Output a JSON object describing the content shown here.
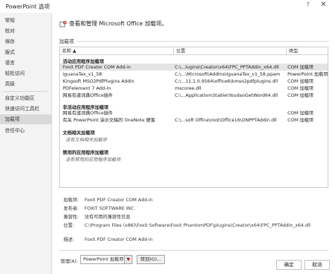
{
  "window": {
    "title": "PowerPoint 选项",
    "help": "?",
    "close": "✕"
  },
  "sidebar": {
    "items": [
      {
        "label": "常规"
      },
      {
        "label": "校对"
      },
      {
        "label": "保存"
      },
      {
        "label": "版式"
      },
      {
        "label": "语言"
      },
      {
        "label": "轻松访问"
      },
      {
        "label": "高级"
      },
      {
        "label": "自定义功能区"
      },
      {
        "label": "快速访问工具栏"
      },
      {
        "label": "加载项"
      },
      {
        "label": "信任中心"
      }
    ]
  },
  "header": {
    "text": "查看和管理 Microsoft Office 加载项。"
  },
  "addins": {
    "section_label": "加载项",
    "columns": {
      "name": "名称 ▲",
      "location": "位置",
      "type": "类型"
    },
    "groups": [
      {
        "title": "活动应用程序加载项",
        "rows": [
          {
            "name": "Foxit PDF Creator COM Add-in",
            "location": "C:\\...lugins\\Creator\\x64\\FPC_PPTAddin_x64.dll",
            "type": "COM 加载项"
          },
          {
            "name": "IguanaTex_v1_58",
            "location": "C:\\...\\Microsoft\\AddIns\\IguanaTex_v1_58.ppam",
            "type": "PowerPoint 加载项"
          },
          {
            "name": "Kingsoft MSO2PdfPlugins Addin",
            "location": "C:\\...11.1.0.9564\\office6\\kmso2pdfplugins.dll",
            "type": "COM 加载项"
          },
          {
            "name": "PDFelement 7 Add-In",
            "location": "mscoree.dll",
            "type": "COM 加载项"
          },
          {
            "name": "网易有道词典Office插件",
            "location": "C:\\...Application\\Stable\\YoudaoGetWord64.dll",
            "type": "COM 加载项"
          }
        ]
      },
      {
        "title": "非活动应用程序加载项",
        "rows": [
          {
            "name": "网易有道词典Office插件",
            "location": "",
            "type": "COM 加载项"
          },
          {
            "name": "有关 PowerPoint 演示文稿的 OneNote 便笺",
            "location": "C:\\...soft Office\\root\\Office16\\ONPPTAddin.dll",
            "type": "COM 加载项"
          }
        ]
      },
      {
        "title": "文档相关加载项",
        "empty": "没有文档相关加载项"
      },
      {
        "title": "禁用的应用程序加载项",
        "empty": "没有禁用的应用程序加载项"
      }
    ]
  },
  "details": {
    "addin_label": "加载项:",
    "addin_value": "Foxit PDF Creator COM Add-in",
    "publisher_label": "发布者:",
    "publisher_value": "FOXIT SOFTWARE INC.",
    "compat_label": "兼容性:",
    "compat_value": "没有可用的兼容性信息",
    "location_label": "位置:",
    "location_value": "C:\\Program Files (x86)\\Foxit Software\\Foxit PhantomPDF\\plugins\\Creator\\x64\\FPC_PPTAddin_x64.dll",
    "desc_label": "描述:",
    "desc_value": "Foxit PDF Creator COM Add-in"
  },
  "manage": {
    "label": "管理(A):",
    "selected": "PowerPoint 加载项",
    "goto": "转到(G)..."
  },
  "footer": {
    "ok": "确定",
    "cancel": "取消"
  }
}
